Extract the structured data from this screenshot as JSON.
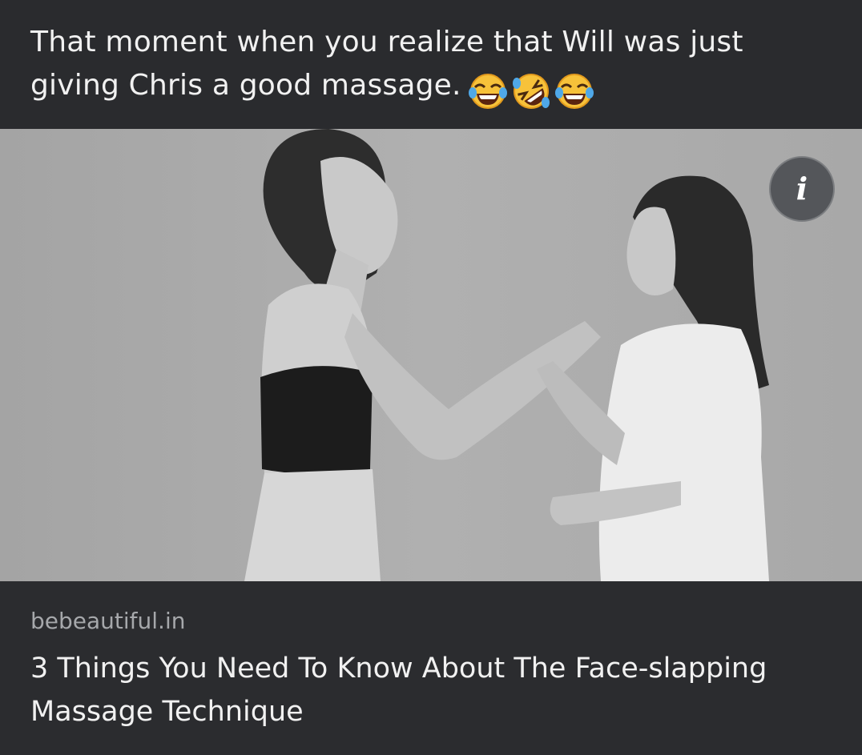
{
  "post": {
    "caption": "That moment when you realize that Will was just giving Chris a good massage.",
    "caption_emojis": [
      "face-with-tears-of-joy-icon",
      "rolling-on-the-floor-laughing-icon",
      "face-with-tears-of-joy-icon"
    ]
  },
  "media": {
    "info_button_label": "i"
  },
  "link_preview": {
    "domain": "bebeautiful.in",
    "title": "3 Things You Need To Know About The Face-slapping Massage Technique"
  },
  "colors": {
    "background": "#2a2b2e",
    "text_primary": "#f1f1f1",
    "text_secondary": "#a6a8ab",
    "info_button_bg": "#54565a"
  }
}
